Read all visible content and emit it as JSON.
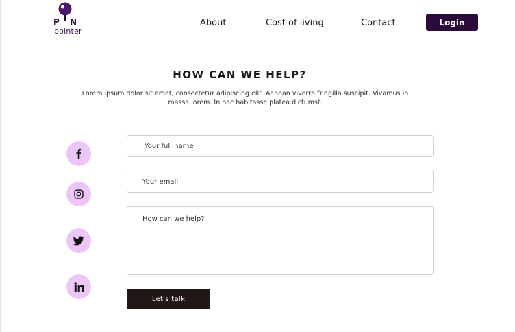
{
  "brand": {
    "logo_letter_left": "P",
    "logo_letter_right": "N",
    "logo_word": "pointer",
    "color": "#2a0a3a"
  },
  "nav": {
    "items": [
      {
        "label": "About"
      },
      {
        "label": "Cost of living"
      },
      {
        "label": "Contact"
      }
    ],
    "login_label": "Login"
  },
  "main": {
    "heading": "HOW CAN WE HELP?",
    "subtext": "Lorem ipsum dolor sit amet, consectetur adipiscing elit. Aenean viverra fringilla suscipit. Vivamus in massa lorem. In hac habitasse platea dictumst."
  },
  "social": {
    "accent": "#ecc6f6",
    "icons": [
      "facebook-icon",
      "instagram-icon",
      "twitter-icon",
      "linkedin-icon"
    ]
  },
  "form": {
    "name_placeholder": "Your full name",
    "email_placeholder": "Your email",
    "message_placeholder": "How can we help?",
    "submit_label": "Let's talk",
    "submit_color": "#231818"
  }
}
